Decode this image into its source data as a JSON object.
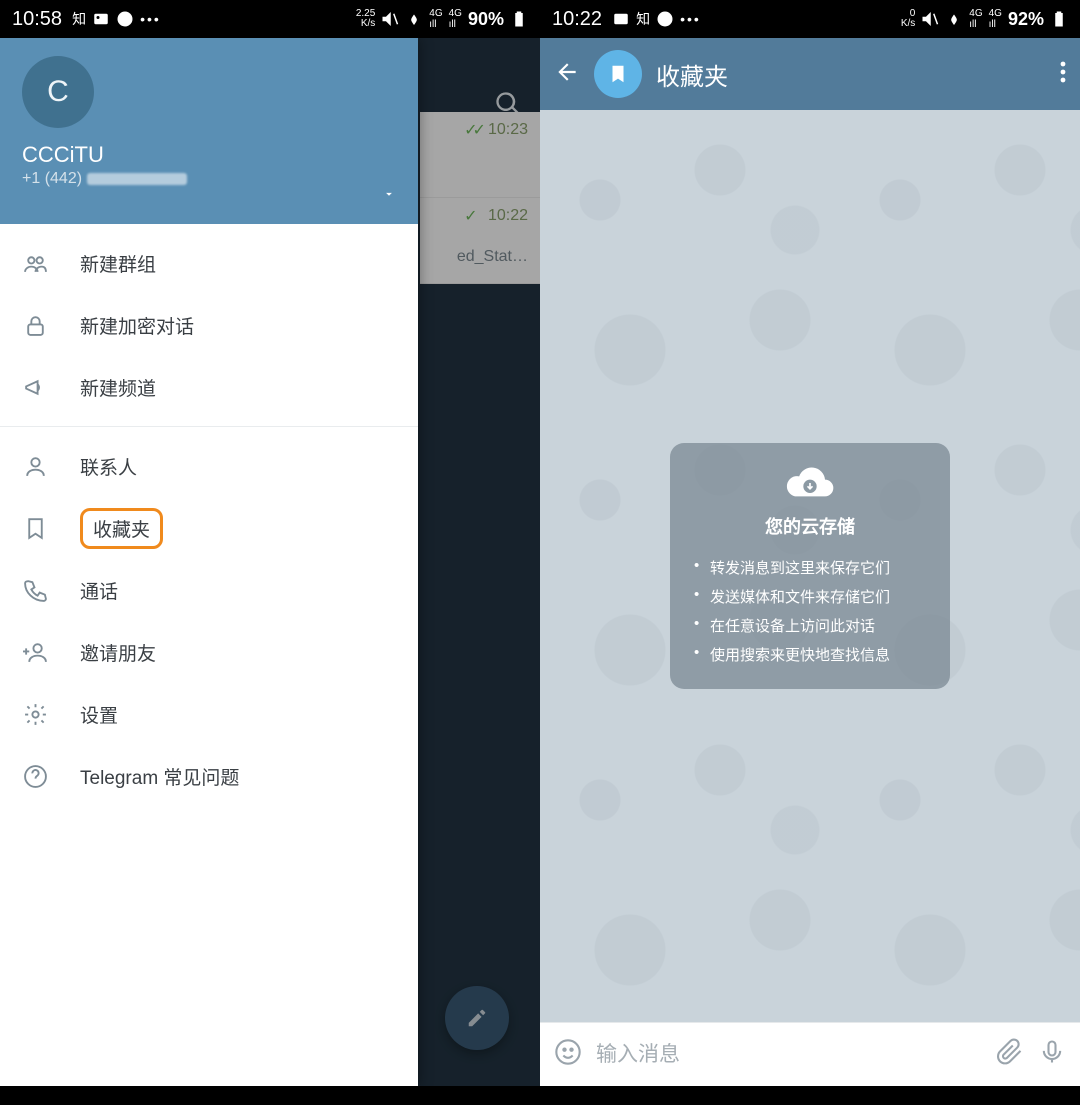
{
  "left": {
    "status": {
      "time": "10:58",
      "net_rate": "2.25\nK/s",
      "battery": "90%"
    },
    "drawer_header": {
      "avatar_letter": "C",
      "name": "CCCiTU",
      "phone_prefix": "+1 (442)"
    },
    "menu": {
      "new_group": "新建群组",
      "secret_chat": "新建加密对话",
      "new_channel": "新建频道",
      "contacts": "联系人",
      "saved": "收藏夹",
      "calls": "通话",
      "invite": "邀请朋友",
      "settings": "设置",
      "faq": "Telegram 常见问题"
    },
    "bg_chat": {
      "row1_time": "10:23",
      "row2_time": "10:22",
      "row2_preview": "ed_Stat…"
    }
  },
  "right": {
    "status": {
      "time": "10:22",
      "net_rate": "0\nK/s",
      "battery": "92%"
    },
    "topbar_title": "收藏夹",
    "info": {
      "title": "您的云存储",
      "b1": "转发消息到这里来保存它们",
      "b2": "发送媒体和文件来存储它们",
      "b3": "在任意设备上访问此对话",
      "b4": "使用搜索来更快地查找信息"
    },
    "composer_placeholder": "输入消息"
  }
}
